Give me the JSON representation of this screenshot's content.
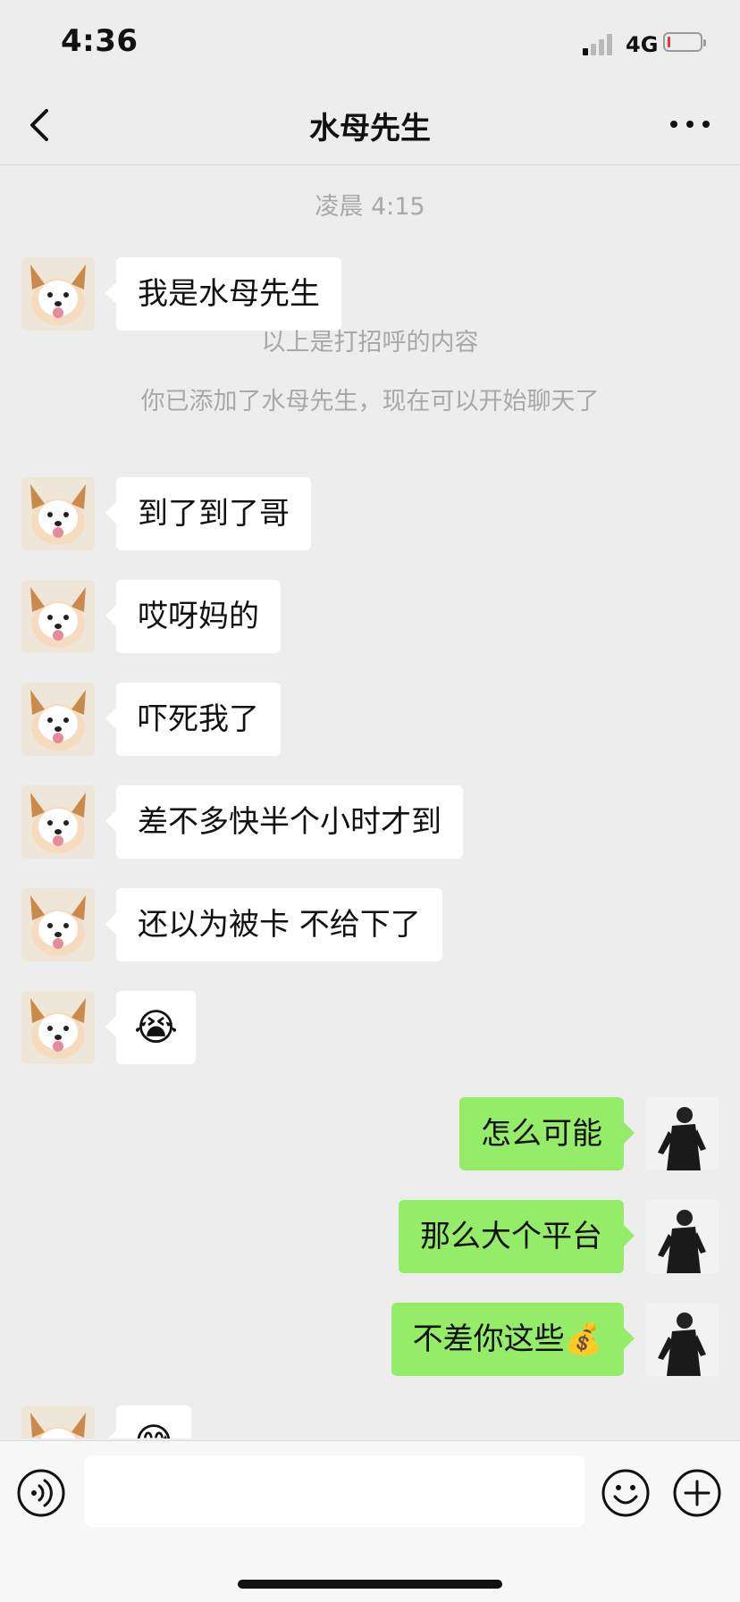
{
  "status_bar": {
    "time": "4:36",
    "network": "4G",
    "signal_bars_active": 1,
    "battery_level": 0.1
  },
  "nav": {
    "title": "水母先生"
  },
  "chat": {
    "system": {
      "timestamp": "凌晨 4:15",
      "greeting_note": "以上是打招呼的内容",
      "added_note": "你已添加了水母先生，现在可以开始聊天了"
    },
    "messages": [
      {
        "side": "in",
        "text": "我是水母先生"
      },
      {
        "side": "in",
        "text": "到了到了哥"
      },
      {
        "side": "in",
        "text": "哎呀妈的"
      },
      {
        "side": "in",
        "text": "吓死我了"
      },
      {
        "side": "in",
        "text": "差不多快半个小时才到"
      },
      {
        "side": "in",
        "text": "还以为被卡 不给下了"
      },
      {
        "side": "in",
        "text": "😭"
      },
      {
        "side": "out",
        "text": "怎么可能"
      },
      {
        "side": "out",
        "text": "那么大个平台"
      },
      {
        "side": "out",
        "text": "不差你这些💰"
      },
      {
        "side": "in",
        "text": "😅"
      }
    ]
  },
  "input": {
    "value": "",
    "placeholder": ""
  },
  "colors": {
    "background": "#ededed",
    "incoming_bubble": "#ffffff",
    "outgoing_bubble": "#95ec69"
  },
  "icons": [
    "back-arrow-icon",
    "more-dots-icon",
    "voice-icon",
    "emoji-smile-icon",
    "plus-icon"
  ]
}
